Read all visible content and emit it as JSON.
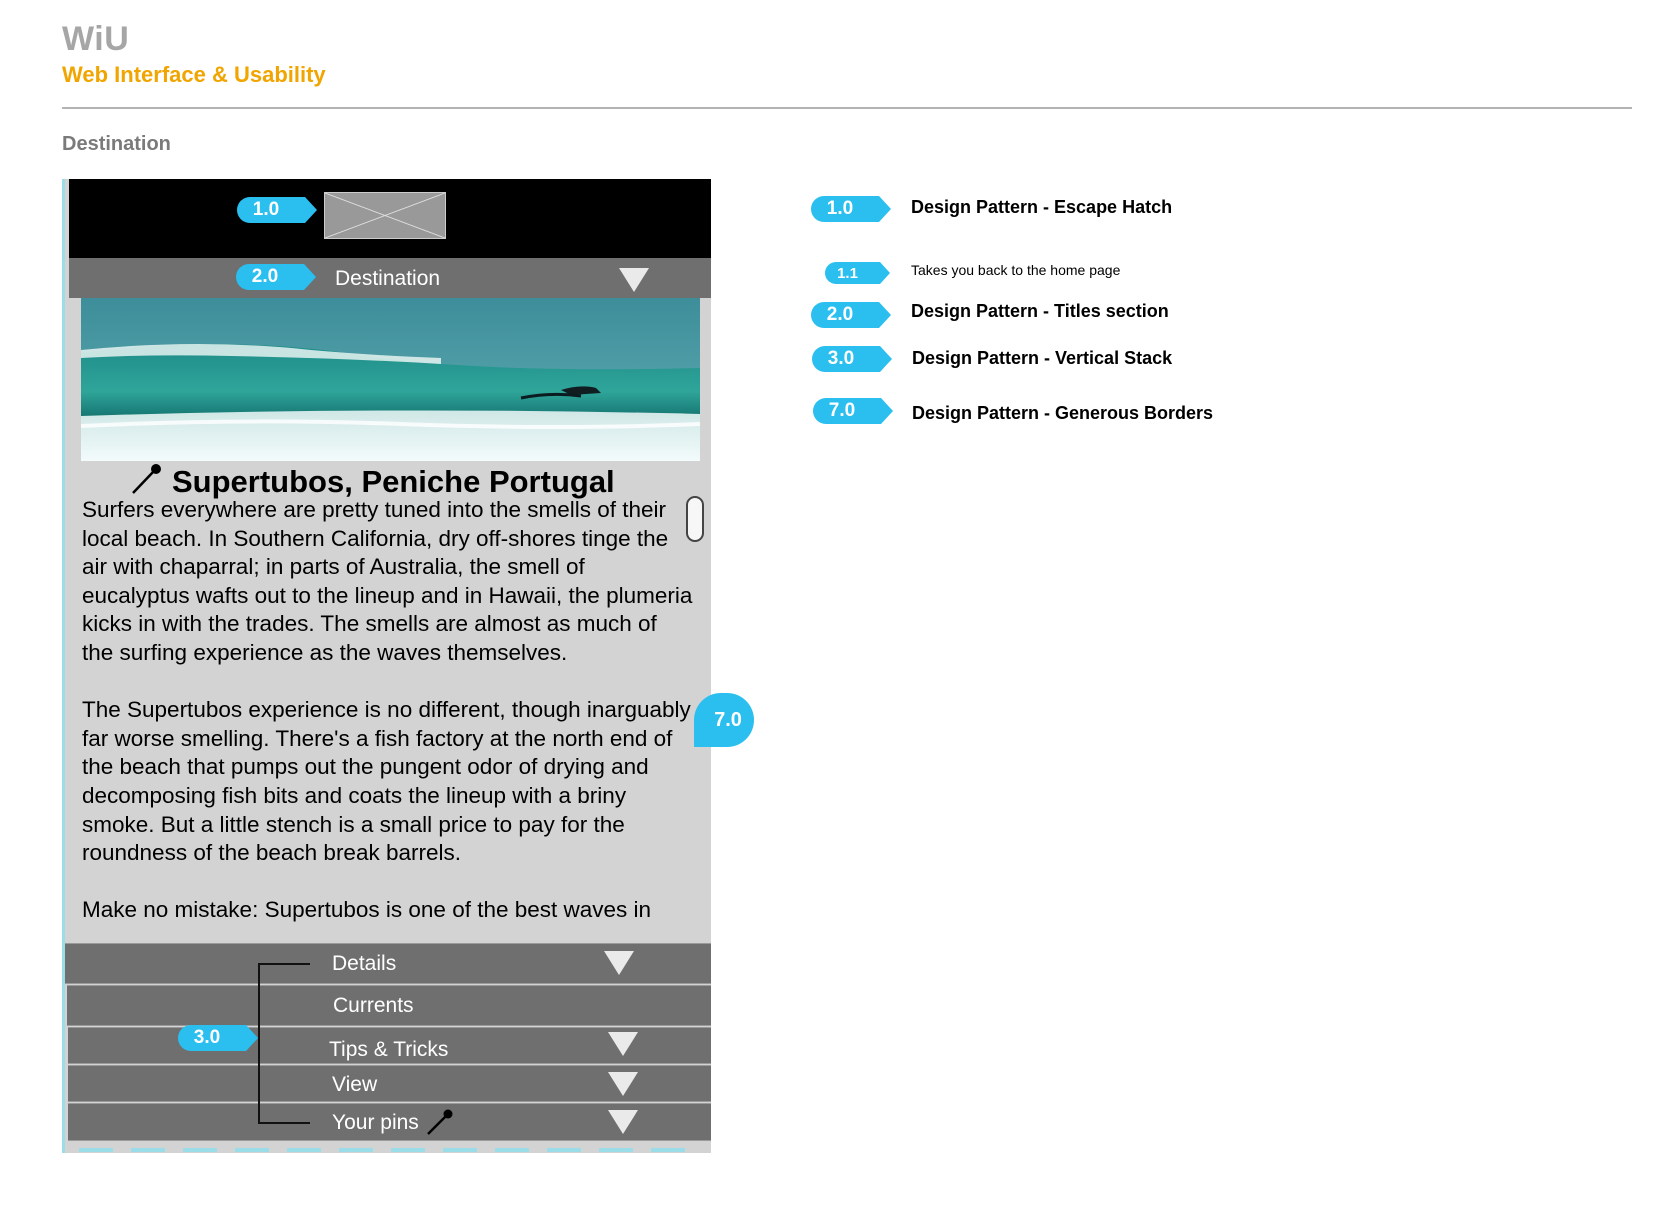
{
  "brand": {
    "title": "WiU",
    "subtitle": "Web Interface & Usability"
  },
  "page": {
    "heading": "Destination"
  },
  "mockup": {
    "titlebar_label": "Destination",
    "article": {
      "title": "Supertubos, Peniche Portugal",
      "paragraphs": [
        "Surfers everywhere are pretty tuned into the smells of their local beach. In Southern California, dry off-shores tinge the air with chaparral; in parts of Australia, the smell of eucalyptus wafts out to the lineup and in Hawaii, the plumeria kicks in with the trades. The smells are almost as much of the surfing experience as the waves themselves.",
        "The Supertubos experience is no different, though inarguably far worse smelling. There's a fish factory at the north end of the beach that pumps out the pungent odor of drying and decomposing fish bits and coats the lineup with a briny smoke. But a little stench is a small price to pay for the roundness of the beach break barrels.",
        "Make no mistake: Supertubos is one of the best waves in"
      ]
    },
    "accordion": [
      {
        "label": "Details"
      },
      {
        "label": "Currents"
      },
      {
        "label": "Tips & Tricks"
      },
      {
        "label": "View"
      },
      {
        "label": "Your pins"
      }
    ]
  },
  "callouts": {
    "c1": "1.0",
    "c2": "2.0",
    "c3": "3.0",
    "c7": "7.0"
  },
  "legend": [
    {
      "num": "1.0",
      "text": "Design Pattern - Escape Hatch"
    },
    {
      "num": "1.1",
      "text": "Takes you back to the home page"
    },
    {
      "num": "2.0",
      "text": "Design Pattern - Titles section"
    },
    {
      "num": "3.0",
      "text": "Design Pattern -  Vertical Stack"
    },
    {
      "num": "7.0",
      "text": "Design Pattern - Generous Borders"
    }
  ],
  "colors": {
    "accent": "#2bbff0",
    "brand_orange": "#f0a500",
    "bar_gray": "#6f6f6f",
    "panel_gray": "#d3d3d3"
  },
  "icons": [
    "image-placeholder-icon",
    "dropdown-arrow-icon",
    "pin-icon"
  ]
}
